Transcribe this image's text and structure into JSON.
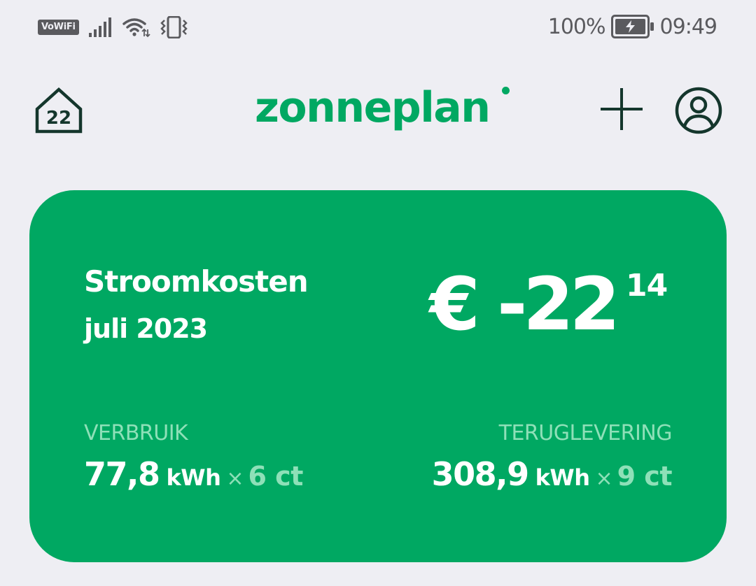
{
  "status_bar": {
    "vowifi_label": "VoWiFi",
    "battery_percent": "100%",
    "time": "09:49",
    "icons": [
      "signal-icon",
      "wifi-icon",
      "vibrate-icon",
      "battery-charging-icon"
    ]
  },
  "header": {
    "house_number": "22",
    "logo_text": "zonneplan",
    "icons": [
      "house-icon",
      "plus-icon",
      "profile-icon"
    ]
  },
  "card": {
    "title": "Stroomkosten",
    "period": "juli 2023",
    "amount_main": "€ -22",
    "amount_cents": "14",
    "usage": {
      "label": "VERBRUIK",
      "value": "77,8",
      "unit": "kWh",
      "times": "×",
      "price": "6 ct"
    },
    "return": {
      "label": "TERUGLEVERING",
      "value": "308,9",
      "unit": "kWh",
      "times": "×",
      "price": "9 ct"
    }
  },
  "colors": {
    "background": "#EEEEF3",
    "brand_green": "#00A862",
    "light_green_text": "#8EE0B8",
    "dark_icon": "#14362C",
    "status_grey": "#5A5A5E"
  }
}
